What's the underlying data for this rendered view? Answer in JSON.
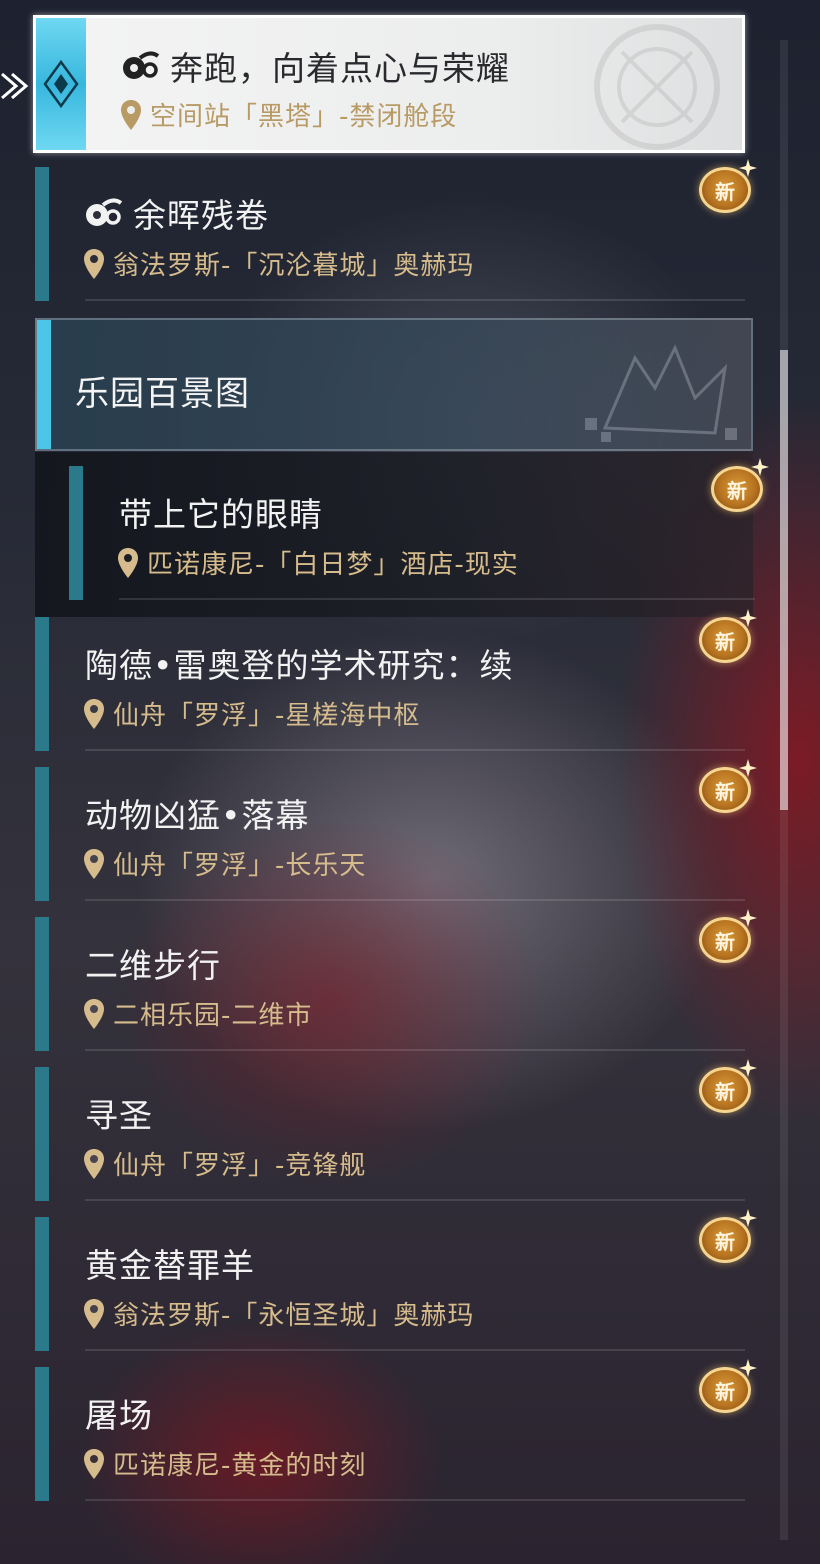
{
  "colors": {
    "accent_cyan": "#4cc6e8",
    "bar_teal": "#2b7a8c",
    "location_gold": "#d6bc8c",
    "badge_orange": "#c07d25"
  },
  "active_item": {
    "icon": "quest-swirl-icon",
    "title": "奔跑，向着点心与荣耀",
    "location": "空间站「黑塔」-禁闭舱段"
  },
  "item_yuhui": {
    "icon": "quest-swirl-icon",
    "title": "余晖残卷",
    "location": "翁法罗斯-「沉沦暮城」奥赫玛",
    "badge": "新"
  },
  "category": {
    "title": "乐园百景图"
  },
  "sub_item": {
    "title": "带上它的眼睛",
    "location": "匹诺康尼-「白日梦」酒店-现实",
    "badge": "新"
  },
  "items": [
    {
      "title": "陶德•雷奥登的学术研究：续",
      "location": "仙舟「罗浮」-星槎海中枢",
      "badge": "新"
    },
    {
      "title": "动物凶猛•落幕",
      "location": "仙舟「罗浮」-长乐天",
      "badge": "新"
    },
    {
      "title": "二维步行",
      "location": "二相乐园-二维市",
      "badge": "新"
    },
    {
      "title": "寻圣",
      "location": "仙舟「罗浮」-竞锋舰",
      "badge": "新"
    },
    {
      "title": "黄金替罪羊",
      "location": "翁法罗斯-「永恒圣城」奥赫玛",
      "badge": "新"
    },
    {
      "title": "屠场",
      "location": "匹诺康尼-黄金的时刻",
      "badge": "新"
    }
  ]
}
